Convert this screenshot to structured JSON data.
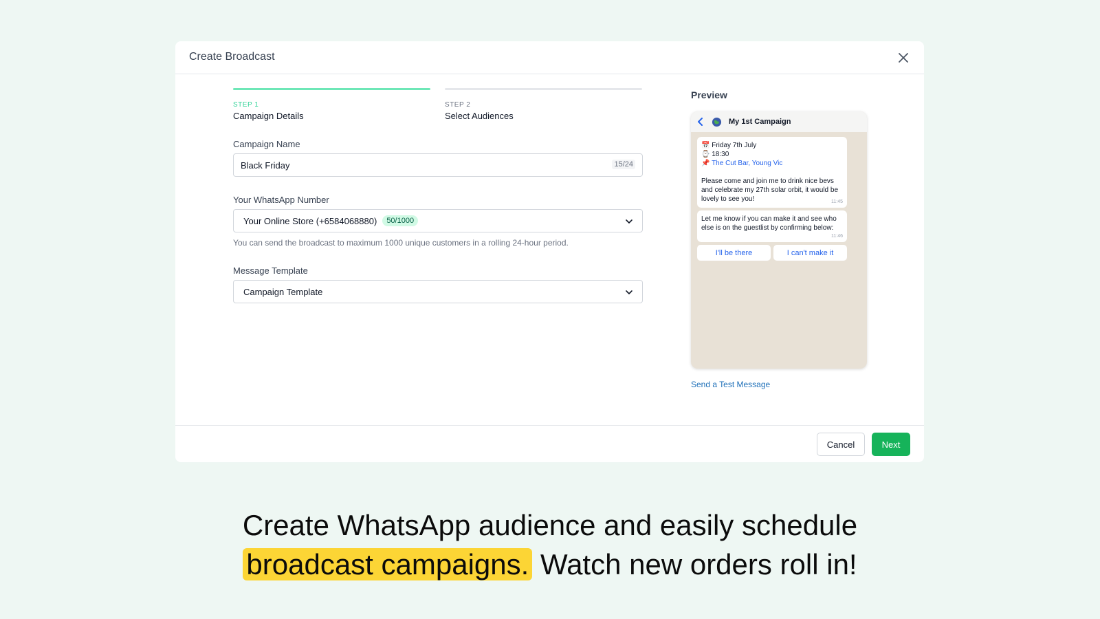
{
  "modal": {
    "title": "Create Broadcast"
  },
  "steps": [
    {
      "num": "STEP 1",
      "label": "Campaign Details"
    },
    {
      "num": "STEP 2",
      "label": "Select Audiences"
    }
  ],
  "fields": {
    "campaign_name": {
      "label": "Campaign Name",
      "value": "Black Friday",
      "counter": "15/24"
    },
    "whatsapp_number": {
      "label": "Your WhatsApp Number",
      "value": "Your Online Store (+6584068880)",
      "badge": "50/1000",
      "helper": "You can send the broadcast to maximum 1000 unique customers in a rolling 24-hour period."
    },
    "template": {
      "label": "Message Template",
      "value": "Campaign Template"
    }
  },
  "preview": {
    "title": "Preview",
    "chat_name": "My 1st Campaign",
    "msg1": {
      "date": "Friday 7th July",
      "time": "18:30",
      "place": "The Cut Bar, Young Vic",
      "body": "Please come and join me to drink nice bevs and celebrate my 27th solar orbit, it would be lovely to see you!",
      "stamp": "11:45"
    },
    "msg2": {
      "body": "Let me know if you can make it and see who else is on the guestlist by confirming below:",
      "stamp": "11:46"
    },
    "reply_yes": "I'll be there",
    "reply_no": "I can't make it",
    "test_link": "Send a Test Message"
  },
  "footer": {
    "cancel": "Cancel",
    "next": "Next"
  },
  "tagline": {
    "line1": "Create WhatsApp audience and easily schedule",
    "highlight": "broadcast campaigns.",
    "line2_rest": "Watch new orders roll in!"
  },
  "colors": {
    "accent": "#16b35a",
    "step_active": "#6ee7b7",
    "highlight": "#fcd535",
    "background": "#eef7f3"
  }
}
